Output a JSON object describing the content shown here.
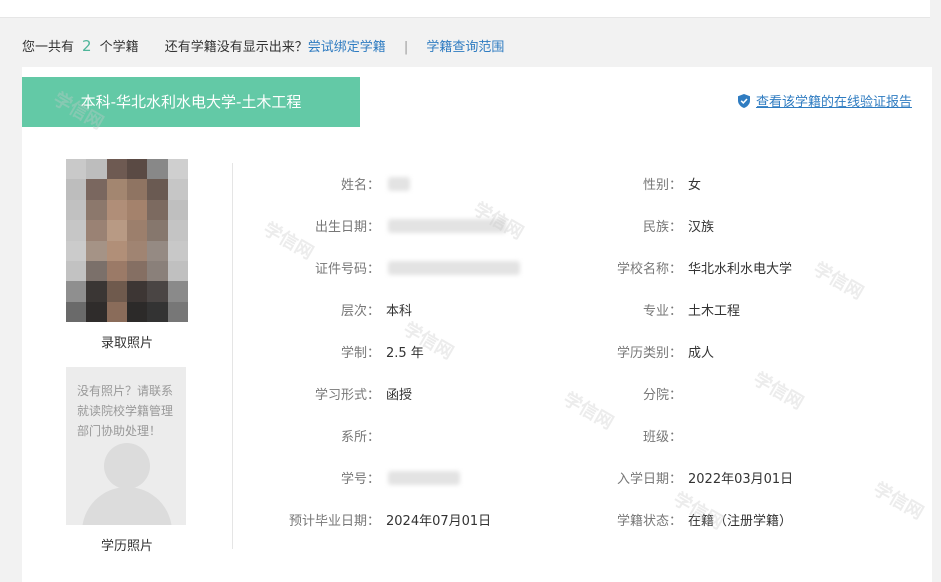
{
  "summary": {
    "prefix": "您一共有",
    "count": "2",
    "suffix": "个学籍",
    "question": "还有学籍没有显示出来？",
    "bind_link": "尝试绑定学籍",
    "separator": "|",
    "scope_link": "学籍查询范围"
  },
  "card": {
    "title": "本科-华北水利水电大学-土木工程",
    "verify_link": "查看该学籍的在线验证报告",
    "verify_icon": "shield-check-icon",
    "watermark": "学信网"
  },
  "photos": {
    "admission_label": "录取照片",
    "degree_label": "学历照片",
    "no_photo_msg": "没有照片？请联系就读院校学籍管理部门协助处理！"
  },
  "left_fields": [
    {
      "label": "姓名：",
      "value": ""
    },
    {
      "label": "出生日期：",
      "value": ""
    },
    {
      "label": "证件号码：",
      "value": ""
    },
    {
      "label": "层次：",
      "value": "本科"
    },
    {
      "label": "学制：",
      "value": "2.5 年"
    },
    {
      "label": "学习形式：",
      "value": "函授"
    },
    {
      "label": "系所：",
      "value": ""
    },
    {
      "label": "学号：",
      "value": ""
    },
    {
      "label": "预计毕业日期：",
      "value": "2024年07月01日"
    }
  ],
  "right_fields": [
    {
      "label": "性别：",
      "value": "女"
    },
    {
      "label": "民族：",
      "value": "汉族"
    },
    {
      "label": "学校名称：",
      "value": "华北水利水电大学"
    },
    {
      "label": "专业：",
      "value": "土木工程"
    },
    {
      "label": "学历类别：",
      "value": "成人"
    },
    {
      "label": "分院：",
      "value": ""
    },
    {
      "label": "班级：",
      "value": ""
    },
    {
      "label": "入学日期：",
      "value": "2022年03月01日"
    },
    {
      "label": "学籍状态：",
      "value": "在籍（注册学籍）"
    }
  ],
  "colors": {
    "accent": "#63c9a6",
    "link": "#2f7cc1",
    "count": "#4fb59a"
  }
}
